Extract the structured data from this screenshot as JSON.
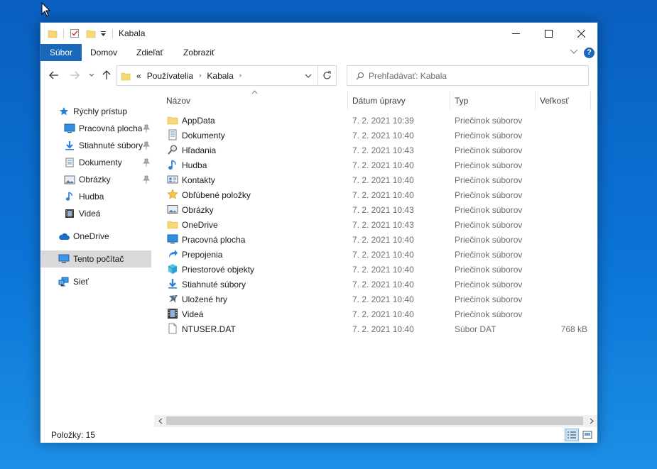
{
  "window": {
    "title": "Kabala",
    "caption_buttons": [
      "minimize",
      "maximize",
      "close"
    ]
  },
  "ribbon": {
    "tabs": [
      {
        "label": "Súbor",
        "active": true
      },
      {
        "label": "Domov",
        "active": false
      },
      {
        "label": "Zdieľať",
        "active": false
      },
      {
        "label": "Zobraziť",
        "active": false
      }
    ],
    "help_label": "?"
  },
  "nav": {
    "back": "back-arrow-icon",
    "forward": "forward-arrow-icon",
    "recent": "chevron-down-icon",
    "up": "up-arrow-icon",
    "address": {
      "overflow": "«",
      "segments": [
        "Používatelia",
        "Kabala"
      ]
    },
    "search_placeholder": "Prehľadávať: Kabala"
  },
  "sidebar": {
    "items": [
      {
        "label": "Rýchly prístup",
        "icon": "star-icon",
        "pinned": false,
        "selected": false
      },
      {
        "label": "Pracovná plocha",
        "icon": "desktop-icon",
        "pinned": true,
        "selected": false
      },
      {
        "label": "Stiahnuté súbory",
        "icon": "download-icon",
        "pinned": true,
        "selected": false
      },
      {
        "label": "Dokumenty",
        "icon": "documents-icon",
        "pinned": true,
        "selected": false
      },
      {
        "label": "Obrázky",
        "icon": "pictures-icon",
        "pinned": true,
        "selected": false
      },
      {
        "label": "Hudba",
        "icon": "music-icon",
        "pinned": false,
        "selected": false
      },
      {
        "label": "Videá",
        "icon": "videos-icon",
        "pinned": false,
        "selected": false
      },
      {
        "label": "OneDrive",
        "icon": "cloud-icon",
        "pinned": false,
        "selected": false
      },
      {
        "label": "Tento počítač",
        "icon": "computer-icon",
        "pinned": false,
        "selected": true
      },
      {
        "label": "Sieť",
        "icon": "network-icon",
        "pinned": false,
        "selected": false
      }
    ]
  },
  "columns": {
    "name": "Názov",
    "date": "Dátum úpravy",
    "type": "Typ",
    "size": "Veľkosť",
    "sort_indicator": "^"
  },
  "files": [
    {
      "name": "AppData",
      "date": "7. 2. 2021 10:39",
      "type": "Priečinok súborov",
      "size": "",
      "icon": "folder-icon"
    },
    {
      "name": "Dokumenty",
      "date": "7. 2. 2021 10:40",
      "type": "Priečinok súborov",
      "size": "",
      "icon": "documents-icon"
    },
    {
      "name": "Hľadania",
      "date": "7. 2. 2021 10:43",
      "type": "Priečinok súborov",
      "size": "",
      "icon": "search-icon"
    },
    {
      "name": "Hudba",
      "date": "7. 2. 2021 10:40",
      "type": "Priečinok súborov",
      "size": "",
      "icon": "music-icon"
    },
    {
      "name": "Kontakty",
      "date": "7. 2. 2021 10:40",
      "type": "Priečinok súborov",
      "size": "",
      "icon": "contacts-icon"
    },
    {
      "name": "Obľúbené položky",
      "date": "7. 2. 2021 10:40",
      "type": "Priečinok súborov",
      "size": "",
      "icon": "star-icon"
    },
    {
      "name": "Obrázky",
      "date": "7. 2. 2021 10:43",
      "type": "Priečinok súborov",
      "size": "",
      "icon": "pictures-icon"
    },
    {
      "name": "OneDrive",
      "date": "7. 2. 2021 10:43",
      "type": "Priečinok súborov",
      "size": "",
      "icon": "folder-icon"
    },
    {
      "name": "Pracovná plocha",
      "date": "7. 2. 2021 10:40",
      "type": "Priečinok súborov",
      "size": "",
      "icon": "desktop-icon"
    },
    {
      "name": "Prepojenia",
      "date": "7. 2. 2021 10:40",
      "type": "Priečinok súborov",
      "size": "",
      "icon": "link-icon"
    },
    {
      "name": "Priestorové objekty",
      "date": "7. 2. 2021 10:40",
      "type": "Priečinok súborov",
      "size": "",
      "icon": "3d-objects-icon"
    },
    {
      "name": "Stiahnuté súbory",
      "date": "7. 2. 2021 10:40",
      "type": "Priečinok súborov",
      "size": "",
      "icon": "download-icon"
    },
    {
      "name": "Uložené hry",
      "date": "7. 2. 2021 10:40",
      "type": "Priečinok súborov",
      "size": "",
      "icon": "saved-games-icon"
    },
    {
      "name": "Videá",
      "date": "7. 2. 2021 10:40",
      "type": "Priečinok súborov",
      "size": "",
      "icon": "videos-icon"
    },
    {
      "name": "NTUSER.DAT",
      "date": "7. 2. 2021 10:40",
      "type": "Súbor DAT",
      "size": "768 kB",
      "icon": "file-icon"
    }
  ],
  "status": {
    "items_label": "Položky: 15"
  },
  "colors": {
    "accent": "#1a66b8",
    "selection": "#d9d9d9",
    "folder": "#f8d775",
    "desktop_bg": "#0b74d6"
  }
}
